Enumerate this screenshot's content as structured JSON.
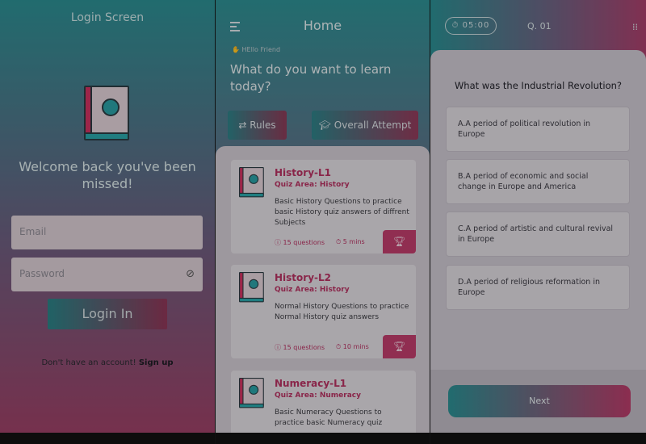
{
  "login": {
    "title": "Login Screen",
    "welcome": "Welcome back you've been missed!",
    "email_placeholder": "Email",
    "password_placeholder": "Password",
    "login_button": "Login In",
    "no_account_text": "Don't have an account!",
    "signup_link": "Sign up"
  },
  "home": {
    "title": "Home",
    "greeting": "HEllo Friend",
    "question": "What do you want to learn today?",
    "rules_label": "Rules",
    "overall_label": "Overall Attempt",
    "cards": [
      {
        "title": "History-L1",
        "area": "Quiz Area: History",
        "desc": "Basic History Questions to practice basic History quiz answers of diffrent Subjects",
        "questions": "15 questions",
        "time": "5 mins"
      },
      {
        "title": "History-L2",
        "area": "Quiz Area: History",
        "desc": "Normal History Questions to practice Normal History quiz answers",
        "questions": "15 questions",
        "time": "10 mins"
      },
      {
        "title": "Numeracy-L1",
        "area": "Quiz Area: Numeracy",
        "desc": "Basic Numeracy Questions to practice basic Numeracy quiz",
        "questions": "",
        "time": ""
      }
    ]
  },
  "quiz": {
    "timer": "05:00",
    "question_number": "Q. 01",
    "question": "What was the Industrial Revolution?",
    "options": [
      "A.A period of political revolution in Europe",
      "B.A period of economic and social change in Europe and America",
      "C.A period of artistic and cultural revival in Europe",
      "D.A period of religious reformation in Europe"
    ],
    "next_label": "Next"
  },
  "colors": {
    "teal": "#2b8a8e",
    "magenta": "#b33a66"
  }
}
